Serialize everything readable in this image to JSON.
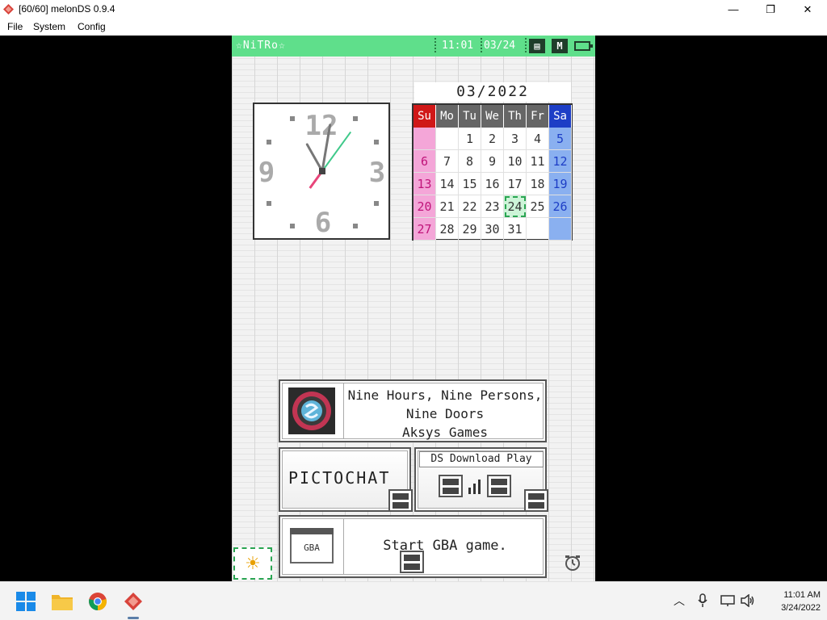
{
  "window": {
    "title": "[60/60] melonDS 0.9.4",
    "minimize": "—",
    "maximize": "❐",
    "close": "✕"
  },
  "menu": {
    "file": "File",
    "system": "System",
    "config": "Config"
  },
  "ds_top": {
    "user_name": "☆NiTRo☆",
    "time": "11:01",
    "date": "03/24",
    "icon_card": "▤",
    "icon_mode": "M",
    "calendar": {
      "title": "03/2022",
      "day_headers": [
        "Su",
        "Mo",
        "Tu",
        "We",
        "Th",
        "Fr",
        "Sa"
      ],
      "weeks": [
        [
          "",
          "",
          "1",
          "2",
          "3",
          "4",
          "5"
        ],
        [
          "6",
          "7",
          "8",
          "9",
          "10",
          "11",
          "12"
        ],
        [
          "13",
          "14",
          "15",
          "16",
          "17",
          "18",
          "19"
        ],
        [
          "20",
          "21",
          "22",
          "23",
          "24",
          "25",
          "26"
        ],
        [
          "27",
          "28",
          "29",
          "30",
          "31",
          "",
          ""
        ]
      ],
      "today": "24"
    },
    "clock_digits": {
      "twelve": "12",
      "three": "3",
      "six": "6",
      "nine": "9"
    },
    "clock_time": {
      "hours": 11,
      "minutes": 1,
      "seconds": 36
    }
  },
  "ds_bottom": {
    "game": {
      "title_line1": "Nine Hours, Nine Persons,",
      "title_line2": "Nine Doors",
      "publisher": "Aksys Games"
    },
    "pictochat": "PICTOCHAT",
    "download_play": "DS Download Play",
    "gba": {
      "cart_label": "GBA",
      "text": "Start GBA game."
    }
  },
  "taskbar": {
    "time": "11:01 AM",
    "date": "3/24/2022"
  },
  "colors": {
    "status_green": "#5fdf8b",
    "sunday_red": "#d01818",
    "saturday_blue": "#1d3ec6",
    "today_green": "#2aa552"
  }
}
